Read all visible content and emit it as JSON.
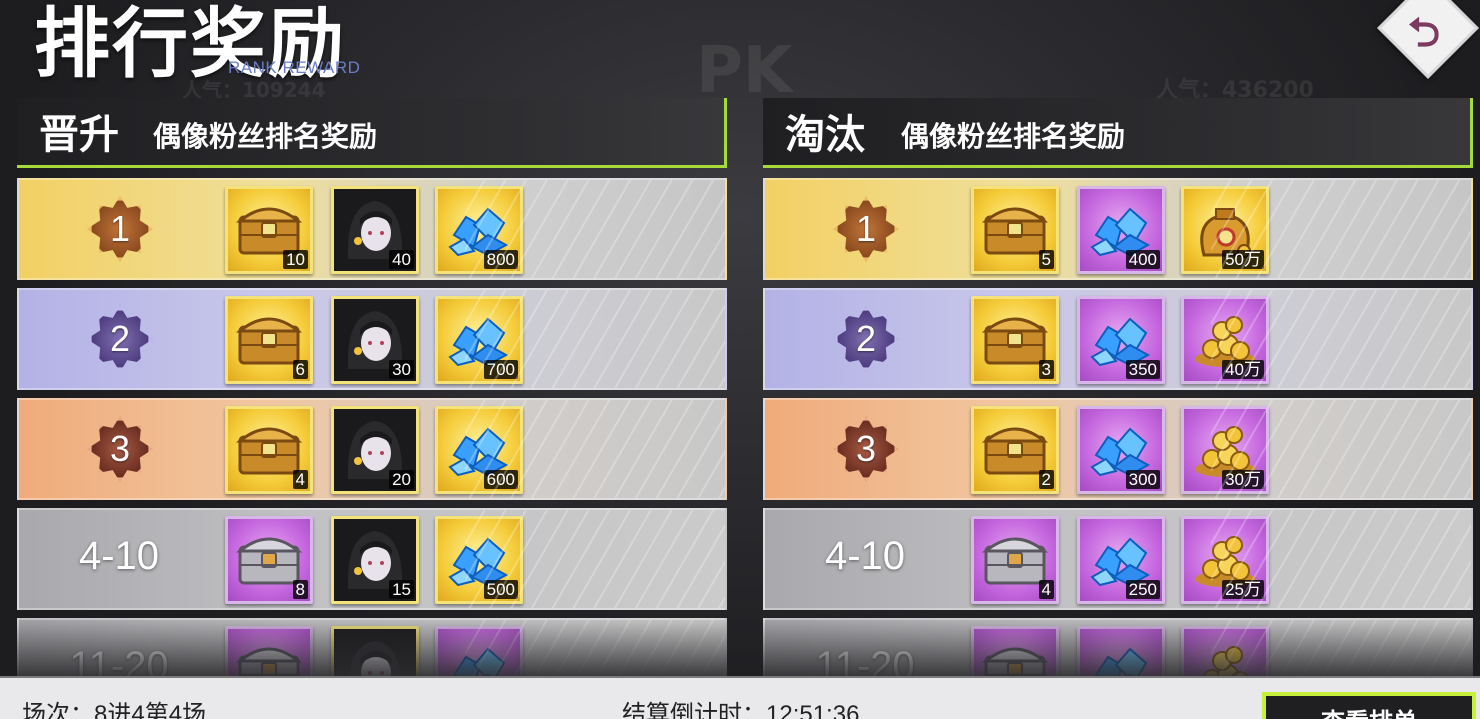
{
  "header": {
    "title": "排行奖励",
    "subtitle": "RANK REWARD",
    "back_icon": "back-arrow-icon"
  },
  "background": {
    "pk_text": "PK",
    "popularity_left": "人气：109244",
    "popularity_right": "人气：436200"
  },
  "panels": [
    {
      "tag": "晋升",
      "title": "偶像粉丝排名奖励",
      "rows": [
        {
          "rank": "1",
          "style": "gold",
          "items": [
            {
              "icon": "gold-chest-icon",
              "bg": "gold",
              "count": "10"
            },
            {
              "icon": "idol-portrait-icon",
              "bg": "dark",
              "count": "40"
            },
            {
              "icon": "blue-diamond-icon",
              "bg": "gold",
              "count": "800"
            }
          ]
        },
        {
          "rank": "2",
          "style": "violet",
          "items": [
            {
              "icon": "gold-chest-icon",
              "bg": "gold",
              "count": "6"
            },
            {
              "icon": "idol-portrait-icon",
              "bg": "dark",
              "count": "30"
            },
            {
              "icon": "blue-diamond-icon",
              "bg": "gold",
              "count": "700"
            }
          ]
        },
        {
          "rank": "3",
          "style": "bronze",
          "items": [
            {
              "icon": "gold-chest-icon",
              "bg": "gold",
              "count": "4"
            },
            {
              "icon": "idol-portrait-icon",
              "bg": "dark",
              "count": "20"
            },
            {
              "icon": "blue-diamond-icon",
              "bg": "gold",
              "count": "600"
            }
          ]
        },
        {
          "rank": "4-10",
          "style": "gray",
          "items": [
            {
              "icon": "silver-chest-icon",
              "bg": "purple",
              "count": "8"
            },
            {
              "icon": "idol-portrait-icon",
              "bg": "dark",
              "count": "15"
            },
            {
              "icon": "blue-diamond-icon",
              "bg": "gold",
              "count": "500"
            }
          ]
        },
        {
          "rank": "11-20",
          "style": "gray",
          "items": [
            {
              "icon": "silver-chest-icon",
              "bg": "purple",
              "count": ""
            },
            {
              "icon": "idol-portrait-icon",
              "bg": "dark",
              "count": ""
            },
            {
              "icon": "blue-diamond-icon",
              "bg": "purple",
              "count": ""
            }
          ]
        }
      ]
    },
    {
      "tag": "淘汰",
      "title": "偶像粉丝排名奖励",
      "rows": [
        {
          "rank": "1",
          "style": "gold",
          "items": [
            {
              "icon": "gold-chest-icon",
              "bg": "gold",
              "count": "5"
            },
            {
              "icon": "blue-diamond-icon",
              "bg": "purple",
              "count": "400"
            },
            {
              "icon": "gold-coin-bag-icon",
              "bg": "gold",
              "count": "50万"
            }
          ]
        },
        {
          "rank": "2",
          "style": "violet",
          "items": [
            {
              "icon": "gold-chest-icon",
              "bg": "gold",
              "count": "3"
            },
            {
              "icon": "blue-diamond-icon",
              "bg": "purple",
              "count": "350"
            },
            {
              "icon": "gold-coin-pile-icon",
              "bg": "purple",
              "count": "40万"
            }
          ]
        },
        {
          "rank": "3",
          "style": "bronze",
          "items": [
            {
              "icon": "gold-chest-icon",
              "bg": "gold",
              "count": "2"
            },
            {
              "icon": "blue-diamond-icon",
              "bg": "purple",
              "count": "300"
            },
            {
              "icon": "gold-coin-pile-icon",
              "bg": "purple",
              "count": "30万"
            }
          ]
        },
        {
          "rank": "4-10",
          "style": "gray",
          "items": [
            {
              "icon": "silver-chest-icon",
              "bg": "purple",
              "count": "4"
            },
            {
              "icon": "blue-diamond-icon",
              "bg": "purple",
              "count": "250"
            },
            {
              "icon": "gold-coin-pile-icon",
              "bg": "purple",
              "count": "25万"
            }
          ]
        },
        {
          "rank": "11-20",
          "style": "gray",
          "items": [
            {
              "icon": "silver-chest-icon",
              "bg": "purple",
              "count": ""
            },
            {
              "icon": "blue-diamond-icon",
              "bg": "purple",
              "count": ""
            },
            {
              "icon": "gold-coin-pile-icon",
              "bg": "purple",
              "count": ""
            }
          ]
        }
      ]
    }
  ],
  "footer": {
    "round": "场次：8进4第4场",
    "countdown": "结算倒计时：12:51:36",
    "check_button": "查看排单"
  }
}
